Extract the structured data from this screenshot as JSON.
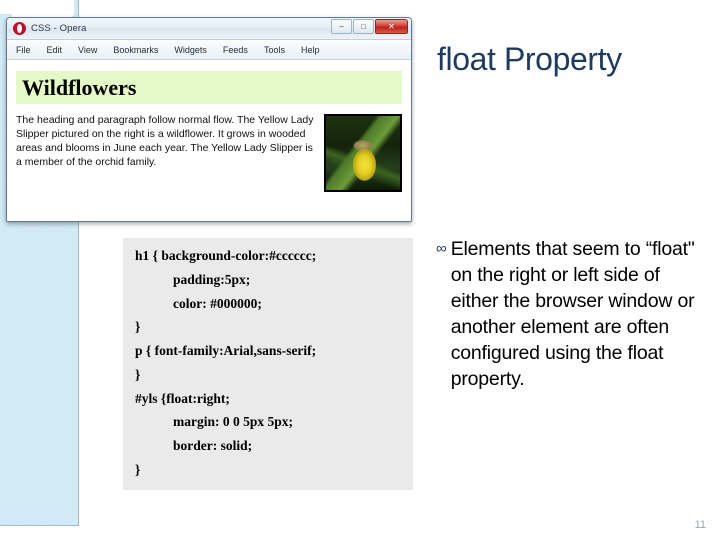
{
  "slide": {
    "title": "float Property",
    "page_number": "11",
    "title_color": "#1f3a5f"
  },
  "browser": {
    "window_title": "CSS - Opera",
    "app_icon": "opera-logo-icon",
    "controls": {
      "minimize": "–",
      "maximize": "□",
      "close": "✕"
    },
    "menu": [
      "File",
      "Edit",
      "View",
      "Bookmarks",
      "Widgets",
      "Feeds",
      "Tools",
      "Help"
    ],
    "page": {
      "heading": "Wildflowers",
      "heading_background": "#e4f8c8",
      "paragraph": "The heading and paragraph follow normal flow. The Yellow Lady Slipper pictured on the right is a wildflower. It grows in wooded areas and blooms in June each year. The Yellow Lady Slipper is a member of the orchid family.",
      "image_alt": "yellow-lady-slipper-orchid-photo"
    }
  },
  "code": {
    "lines": [
      "h1 { background-color:#cccccc;",
      "padding:5px;",
      "color: #000000;",
      "}",
      "p { font-family:Arial,sans-serif;",
      "}",
      "#yls {float:right;",
      "margin: 0 0 5px 5px;",
      "border: solid;",
      "}"
    ],
    "background": "#eaeaea"
  },
  "bullet": {
    "glyph": "∞",
    "text": "Elements that seem to “float\" on the right or left side of either the browser window or another element are often configured using the float property."
  }
}
